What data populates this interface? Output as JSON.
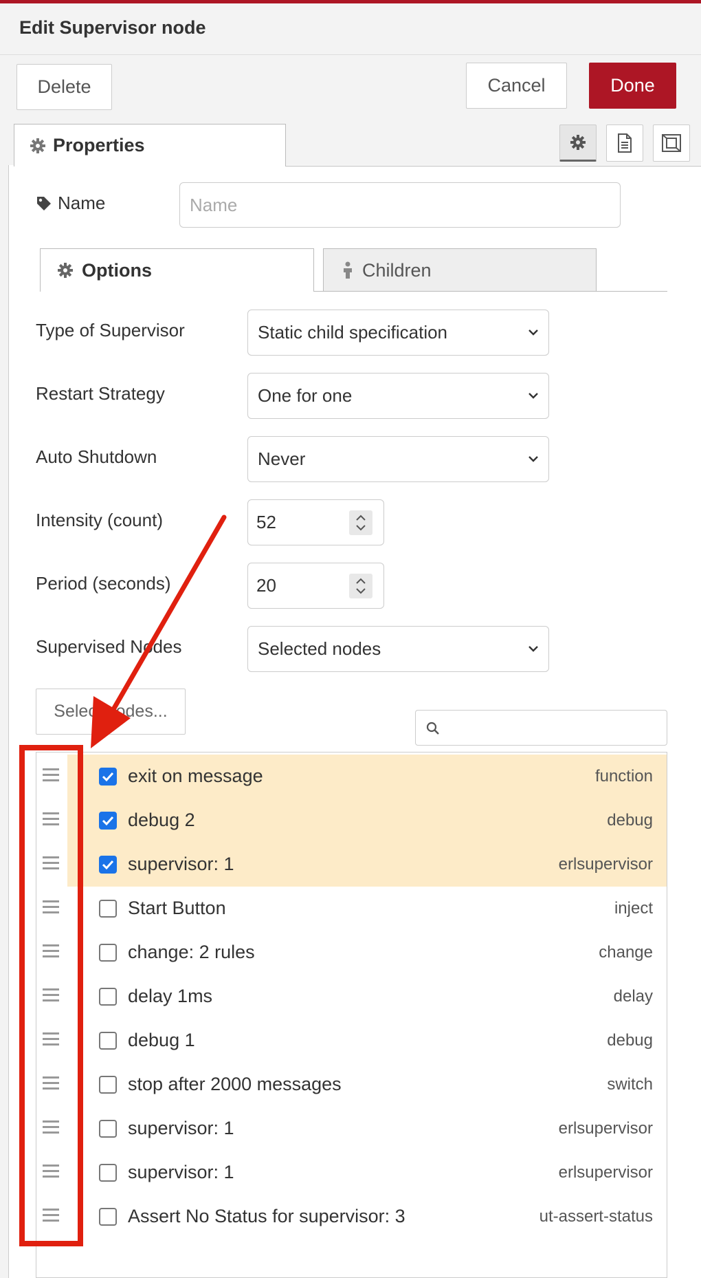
{
  "dialog": {
    "title": "Edit Supervisor node",
    "delete_label": "Delete",
    "cancel_label": "Cancel",
    "done_label": "Done",
    "accent_color": "#ad1625"
  },
  "tabs": {
    "properties_label": "Properties",
    "options_label": "Options",
    "children_label": "Children"
  },
  "toolbar_icons": [
    "gear-icon",
    "description-icon",
    "appearance-icon"
  ],
  "name_field": {
    "label": "Name",
    "placeholder": "Name",
    "value": ""
  },
  "options": {
    "type_label": "Type of Supervisor",
    "type_value": "Static child specification",
    "restart_label": "Restart Strategy",
    "restart_value": "One for one",
    "shutdown_label": "Auto Shutdown",
    "shutdown_value": "Never",
    "intensity_label": "Intensity (count)",
    "intensity_value": "52",
    "period_label": "Period (seconds)",
    "period_value": "20",
    "supervised_label": "Supervised Nodes",
    "supervised_value": "Selected nodes",
    "select_nodes_label": "Select nodes..."
  },
  "nodes": [
    {
      "label": "exit on message",
      "type": "function",
      "checked": true
    },
    {
      "label": "debug 2",
      "type": "debug",
      "checked": true
    },
    {
      "label": "supervisor: 1",
      "type": "erlsupervisor",
      "checked": true
    },
    {
      "label": "Start Button",
      "type": "inject",
      "checked": false
    },
    {
      "label": "change: 2 rules",
      "type": "change",
      "checked": false
    },
    {
      "label": "delay 1ms",
      "type": "delay",
      "checked": false
    },
    {
      "label": "debug 1",
      "type": "debug",
      "checked": false
    },
    {
      "label": "stop after 2000 messages",
      "type": "switch",
      "checked": false
    },
    {
      "label": "supervisor: 1",
      "type": "erlsupervisor",
      "checked": false
    },
    {
      "label": "supervisor: 1",
      "type": "erlsupervisor",
      "checked": false
    },
    {
      "label": "Assert No Status for supervisor: 3",
      "type": "ut-assert-status",
      "checked": false
    }
  ],
  "annotation_color": "#e0200f"
}
